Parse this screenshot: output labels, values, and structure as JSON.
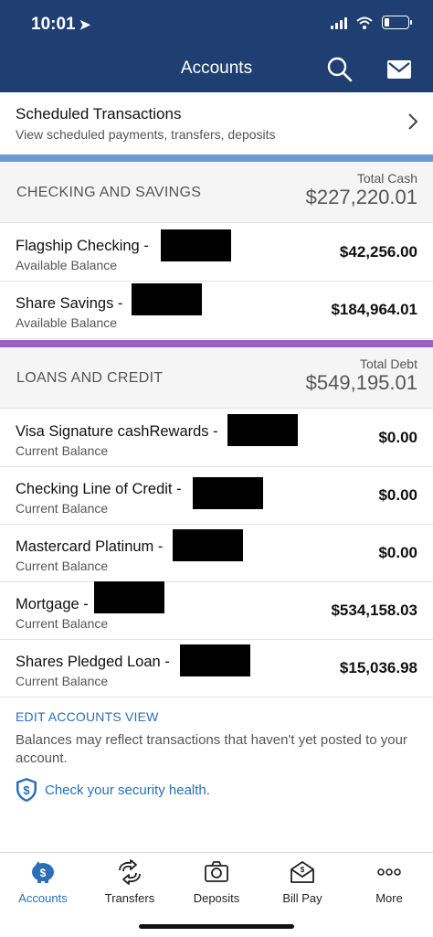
{
  "status": {
    "time": "10:01",
    "location_glyph": "➤"
  },
  "nav": {
    "title": "Accounts",
    "search_icon": "search-icon",
    "mail_icon": "mail-icon"
  },
  "scheduled": {
    "title": "Scheduled Transactions",
    "subtitle": "View scheduled payments, transfers, deposits"
  },
  "checking_section": {
    "title": "CHECKING AND SAVINGS",
    "total_label": "Total Cash",
    "total_value": "$227,220.01",
    "accounts": [
      {
        "name": "Flagship Checking -",
        "sub": "Available Balance",
        "amount": "$42,256.00"
      },
      {
        "name": "Share Savings -",
        "sub": "Available Balance",
        "amount": "$184,964.01"
      }
    ]
  },
  "loans_section": {
    "title": "LOANS AND CREDIT",
    "total_label": "Total Debt",
    "total_value": "$549,195.01",
    "accounts": [
      {
        "name": "Visa Signature cashRewards -",
        "sub": "Current Balance",
        "amount": "$0.00"
      },
      {
        "name": "Checking Line of Credit -",
        "sub": "Current Balance",
        "amount": "$0.00"
      },
      {
        "name": "Mastercard Platinum -",
        "sub": "Current Balance",
        "amount": "$0.00"
      },
      {
        "name": "Mortgage -",
        "sub": "Current Balance",
        "amount": "$534,158.03"
      },
      {
        "name": "Shares Pledged Loan -",
        "sub": "Current Balance",
        "amount": "$15,036.98"
      }
    ]
  },
  "footer": {
    "edit_link": "EDIT ACCOUNTS VIEW",
    "note": "Balances may reflect transactions that haven't yet posted to your account.",
    "security_link": "Check your security health."
  },
  "tabs": [
    {
      "label": "Accounts",
      "icon": "piggy-bank-icon",
      "active": true
    },
    {
      "label": "Transfers",
      "icon": "transfer-arrows-icon",
      "active": false
    },
    {
      "label": "Deposits",
      "icon": "camera-icon",
      "active": false
    },
    {
      "label": "Bill Pay",
      "icon": "envelope-icon",
      "active": false
    },
    {
      "label": "More",
      "icon": "more-dots-icon",
      "active": false
    }
  ],
  "colors": {
    "header_bg": "#1f3f72",
    "checking_divider": "#6c9bd2",
    "loans_divider": "#9a63c3",
    "link": "#2a6fb7"
  }
}
